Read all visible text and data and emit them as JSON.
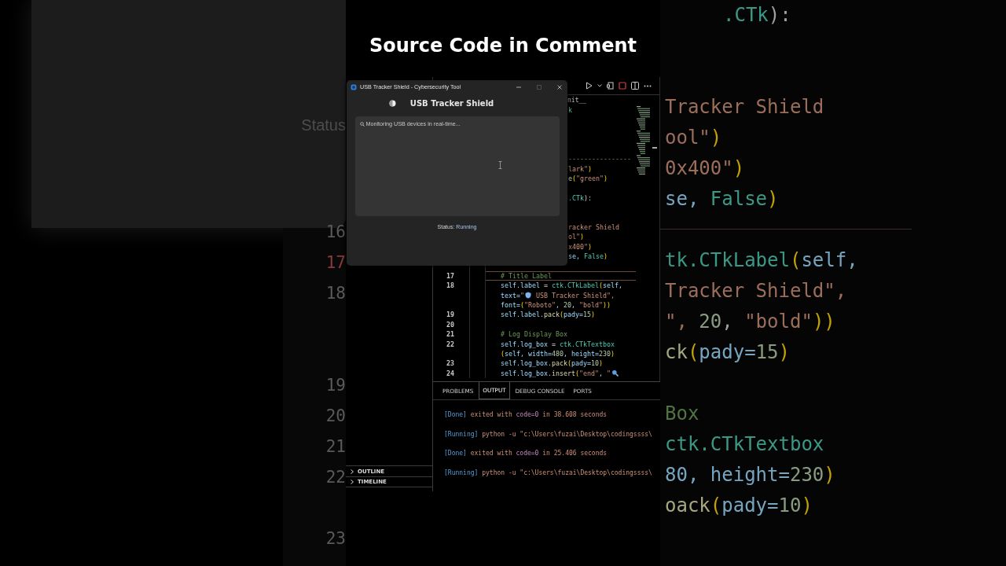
{
  "headline": "Source Code in Comment",
  "backdrop_left": {
    "label": "Status",
    "line_numbers": [
      {
        "kind": "number",
        "num": "16",
        "current": false
      },
      {
        "kind": "number",
        "num": "17",
        "current": true
      },
      {
        "kind": "number",
        "num": "18",
        "current": false
      },
      {
        "kind": "blank"
      },
      {
        "kind": "blank"
      },
      {
        "kind": "number",
        "num": "19",
        "current": false
      },
      {
        "kind": "number",
        "num": "20",
        "current": false
      },
      {
        "kind": "number",
        "num": "21",
        "current": false
      },
      {
        "kind": "number",
        "num": "22",
        "current": false
      },
      {
        "kind": "blank"
      },
      {
        "kind": "number",
        "num": "23",
        "current": false
      }
    ]
  },
  "backdrop_right": {
    "lines": [
      {
        "tokens": [
          {
            "text": ".CTk",
            "kind": "cls"
          },
          {
            "text": "):",
            "kind": "op"
          }
        ]
      },
      {
        "kind": "blank"
      },
      {
        "kind": "blank"
      },
      {
        "tokens": [
          {
            "text": "Tracker Shield",
            "kind": "str"
          }
        ]
      },
      {
        "tokens": [
          {
            "text": "ool\"",
            "kind": "str"
          },
          {
            "text": ")",
            "kind": "paren"
          }
        ]
      },
      {
        "tokens": [
          {
            "text": "0x400\"",
            "kind": "str"
          },
          {
            "text": ")",
            "kind": "paren"
          }
        ]
      },
      {
        "tokens": [
          {
            "text": "se, ",
            "kind": "var"
          },
          {
            "text": "False",
            "kind": "cls"
          },
          {
            "text": ")",
            "kind": "paren"
          }
        ]
      },
      {
        "kind": "blank"
      },
      {
        "tokens": [
          {
            "text": "tk.CTkLabel",
            "kind": "cls"
          },
          {
            "text": "(",
            "kind": "paren"
          },
          {
            "text": "self,",
            "kind": "var"
          }
        ]
      },
      {
        "tokens": [
          {
            "text": "Tracker Shield\",",
            "kind": "str"
          }
        ]
      },
      {
        "tokens": [
          {
            "text": "\", ",
            "kind": "str"
          },
          {
            "text": "20",
            "kind": "num"
          },
          {
            "text": ", ",
            "kind": "op"
          },
          {
            "text": "\"bold\"",
            "kind": "str"
          },
          {
            "text": "))",
            "kind": "paren"
          }
        ]
      },
      {
        "tokens": [
          {
            "text": "ck",
            "kind": "func"
          },
          {
            "text": "(",
            "kind": "paren"
          },
          {
            "text": "pady=",
            "kind": "var"
          },
          {
            "text": "15",
            "kind": "num"
          },
          {
            "text": ")",
            "kind": "paren"
          }
        ]
      },
      {
        "kind": "blank"
      },
      {
        "tokens": [
          {
            "text": "Box",
            "kind": "comment"
          }
        ]
      },
      {
        "tokens": [
          {
            "text": "ctk.CTkTextbox",
            "kind": "cls"
          }
        ]
      },
      {
        "tokens": [
          {
            "text": "80, height=",
            "kind": "var"
          },
          {
            "text": "230",
            "kind": "num"
          },
          {
            "text": ")",
            "kind": "paren"
          }
        ]
      },
      {
        "tokens": [
          {
            "text": "oack",
            "kind": "func"
          },
          {
            "text": "(",
            "kind": "paren"
          },
          {
            "text": "pady=",
            "kind": "var"
          },
          {
            "text": "10",
            "kind": "num"
          },
          {
            "text": ")",
            "kind": "paren"
          }
        ]
      }
    ]
  },
  "editor": {
    "breadcrumb": "nit__",
    "lines": [
      {
        "kind": "partial",
        "tokens": [
          {
            "text": "k",
            "kind": "cls"
          }
        ]
      },
      {
        "kind": "blank"
      },
      {
        "kind": "blank"
      },
      {
        "kind": "blank"
      },
      {
        "kind": "blank"
      },
      {
        "kind": "partial",
        "tokens": [
          {
            "text": "----------------",
            "kind": "comment"
          }
        ]
      },
      {
        "kind": "partial",
        "tokens": [
          {
            "text": "lark\"",
            "kind": "str"
          },
          {
            "text": ")",
            "kind": "paren"
          }
        ]
      },
      {
        "kind": "partial",
        "tokens": [
          {
            "text": "e",
            "kind": "func"
          },
          {
            "text": "(",
            "kind": "paren"
          },
          {
            "text": "\"green\"",
            "kind": "str"
          },
          {
            "text": ")",
            "kind": "paren"
          }
        ]
      },
      {
        "kind": "blank"
      },
      {
        "kind": "partial",
        "tokens": [
          {
            "text": ".CTk",
            "kind": "cls"
          },
          {
            "text": "):",
            "kind": "op"
          }
        ]
      },
      {
        "kind": "blank"
      },
      {
        "kind": "blank"
      },
      {
        "kind": "partial",
        "tokens": [
          {
            "text": "racker Shield",
            "kind": "str"
          }
        ]
      },
      {
        "kind": "partial",
        "tokens": [
          {
            "text": "ol\"",
            "kind": "str"
          },
          {
            "text": ")",
            "kind": "paren"
          }
        ]
      },
      {
        "kind": "partial",
        "tokens": [
          {
            "text": "x400\"",
            "kind": "str"
          },
          {
            "text": ")",
            "kind": "paren"
          }
        ]
      },
      {
        "kind": "partial",
        "tokens": [
          {
            "text": "se, ",
            "kind": "var"
          },
          {
            "text": "False",
            "kind": "cls"
          },
          {
            "text": ")",
            "kind": "paren"
          }
        ]
      },
      {
        "kind": "blank"
      },
      {
        "kind": "code",
        "num": "17",
        "current": true,
        "tokens": [
          {
            "text": "# Title Label",
            "kind": "comment"
          }
        ]
      },
      {
        "kind": "code",
        "num": "18",
        "tokens": [
          {
            "text": "self.label",
            "kind": "var"
          },
          {
            "text": " = ",
            "kind": "op"
          },
          {
            "text": "ctk.CTkLabel",
            "kind": "cls"
          },
          {
            "text": "(",
            "kind": "paren"
          },
          {
            "text": "self,",
            "kind": "var"
          }
        ]
      },
      {
        "kind": "code",
        "tokens": [
          {
            "text": "text=",
            "kind": "var"
          },
          {
            "text": "\"",
            "kind": "str"
          },
          {
            "kind": "emoji-shield"
          },
          {
            "text": " USB Tracker Shield\",",
            "kind": "str"
          }
        ]
      },
      {
        "kind": "code",
        "tokens": [
          {
            "text": "font=",
            "kind": "var"
          },
          {
            "text": "(",
            "kind": "paren"
          },
          {
            "text": "\"Roboto\"",
            "kind": "str"
          },
          {
            "text": ", ",
            "kind": "op"
          },
          {
            "text": "20",
            "kind": "num"
          },
          {
            "text": ", ",
            "kind": "op"
          },
          {
            "text": "\"bold\"",
            "kind": "str"
          },
          {
            "text": "))",
            "kind": "paren"
          }
        ]
      },
      {
        "kind": "code",
        "num": "19",
        "tokens": [
          {
            "text": "self.label.",
            "kind": "var"
          },
          {
            "text": "pack",
            "kind": "func"
          },
          {
            "text": "(",
            "kind": "paren"
          },
          {
            "text": "pady=",
            "kind": "var"
          },
          {
            "text": "15",
            "kind": "num"
          },
          {
            "text": ")",
            "kind": "paren"
          }
        ]
      },
      {
        "kind": "blank",
        "num": "20"
      },
      {
        "kind": "code",
        "num": "21",
        "tokens": [
          {
            "text": "# Log Display Box",
            "kind": "comment"
          }
        ]
      },
      {
        "kind": "code",
        "num": "22",
        "tokens": [
          {
            "text": "self.log_box",
            "kind": "var"
          },
          {
            "text": " = ",
            "kind": "op"
          },
          {
            "text": "ctk.CTkTextbox",
            "kind": "cls"
          }
        ]
      },
      {
        "kind": "code",
        "tokens": [
          {
            "text": "(",
            "kind": "paren"
          },
          {
            "text": "self, width=",
            "kind": "var"
          },
          {
            "text": "480",
            "kind": "num"
          },
          {
            "text": ", height=",
            "kind": "var"
          },
          {
            "text": "230",
            "kind": "num"
          },
          {
            "text": ")",
            "kind": "paren"
          }
        ]
      },
      {
        "kind": "code",
        "num": "23",
        "tokens": [
          {
            "text": "self.log_box.",
            "kind": "var"
          },
          {
            "text": "pack",
            "kind": "func"
          },
          {
            "text": "(",
            "kind": "paren"
          },
          {
            "text": "pady=",
            "kind": "var"
          },
          {
            "text": "10",
            "kind": "num"
          },
          {
            "text": ")",
            "kind": "paren"
          }
        ]
      },
      {
        "kind": "code",
        "num": "24",
        "tokens": [
          {
            "text": "self.log_box.",
            "kind": "var"
          },
          {
            "text": "insert",
            "kind": "func"
          },
          {
            "text": "(",
            "kind": "paren"
          },
          {
            "text": "\"end\"",
            "kind": "str"
          },
          {
            "text": ", ",
            "kind": "op"
          },
          {
            "text": "\"",
            "kind": "str"
          },
          {
            "kind": "emoji-search"
          }
        ]
      }
    ]
  },
  "sidebar": {
    "sections": [
      {
        "label": "OUTLINE",
        "expanded": false
      },
      {
        "label": "TIMELINE",
        "expanded": false
      }
    ]
  },
  "panel": {
    "tabs": [
      {
        "label": "PROBLEMS",
        "selected": false
      },
      {
        "label": "OUTPUT",
        "selected": true
      },
      {
        "label": "DEBUG CONSOLE",
        "selected": false
      },
      {
        "label": "PORTS",
        "selected": false
      }
    ],
    "output": [
      [
        {
          "text": "[Done]",
          "kind": "tag"
        },
        {
          "text": " exited with ",
          "kind": "str"
        },
        {
          "text": "code=0",
          "kind": "key"
        },
        {
          "text": " in 38.608 seconds",
          "kind": "str"
        }
      ],
      [
        {
          "text": "[Running]",
          "kind": "tag"
        },
        {
          "text": " python -u \"c:\\Users\\fuzai\\Desktop\\codingssss\\",
          "kind": "str"
        }
      ],
      [
        {
          "text": "[Done]",
          "kind": "tag"
        },
        {
          "text": " exited with ",
          "kind": "str"
        },
        {
          "text": "code=0",
          "kind": "key"
        },
        {
          "text": " in 25.406 seconds",
          "kind": "str"
        }
      ],
      [
        {
          "text": "[Running]",
          "kind": "tag"
        },
        {
          "text": " python -u \"c:\\Users\\fuzai\\Desktop\\codingssss\\",
          "kind": "str"
        }
      ]
    ]
  },
  "app": {
    "title": "USB Tracker Shield - Cybersecurity Tool",
    "heading": "USB Tracker Shield",
    "log": "Monitoring USB devices in real-time...",
    "status_label": "Status:",
    "status_value": "Running"
  }
}
